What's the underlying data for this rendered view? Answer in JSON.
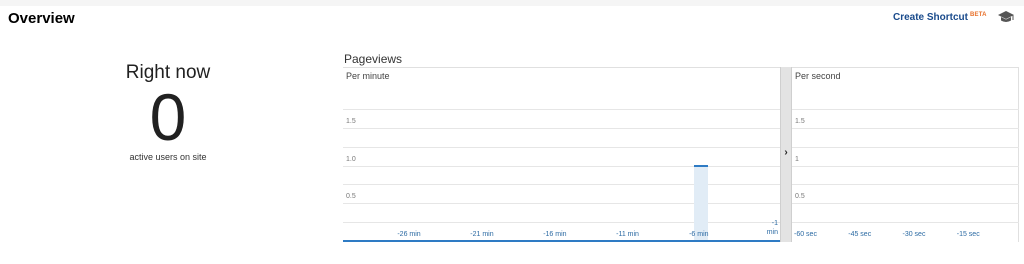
{
  "header": {
    "title": "Overview",
    "create_shortcut": "Create Shortcut",
    "beta": "BETA",
    "icons": [
      "graduation-cap-icon"
    ]
  },
  "right_now": {
    "title": "Right now",
    "count": "0",
    "subtitle": "active users on site"
  },
  "pageviews": {
    "title": "Pageviews",
    "per_minute_label": "Per minute",
    "per_second_label": "Per second",
    "expand_arrow": "›"
  },
  "chart_data": [
    {
      "type": "bar",
      "title": "Per minute",
      "y_ticks": [
        "1.5",
        "1.0",
        "0.5"
      ],
      "x_ticks": [
        "-26 min",
        "-21 min",
        "-16 min",
        "-11 min",
        "-6 min",
        "-1 min"
      ],
      "x_range": [
        -30,
        -1
      ],
      "ylim": [
        0,
        2
      ],
      "values": [
        {
          "x": -6,
          "y": 1
        }
      ],
      "grid": true,
      "colors": {
        "bar": "#2e7bc4",
        "bar_bg": "#e1ecf6"
      }
    },
    {
      "type": "bar",
      "title": "Per second",
      "y_ticks": [
        "1.5",
        "1",
        "0.5"
      ],
      "x_ticks": [
        "-60 sec",
        "-45 sec",
        "-30 sec",
        "-15 sec"
      ],
      "x_range": [
        -60,
        0
      ],
      "ylim": [
        0,
        2
      ],
      "values": [],
      "grid": true
    }
  ]
}
